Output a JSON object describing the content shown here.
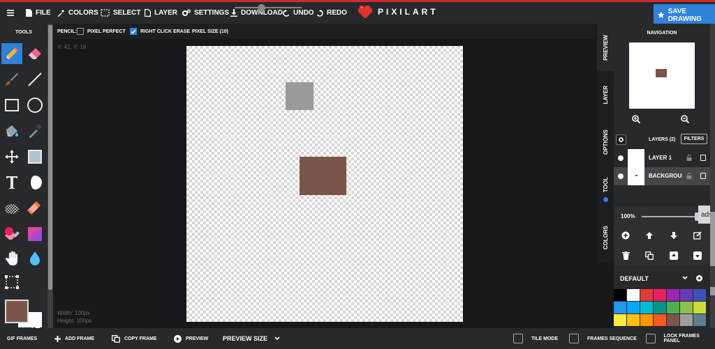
{
  "topbar": {
    "file": "FILE",
    "colors": "COLORS",
    "select": "SELECT",
    "layer": "LAYER",
    "settings": "SETTINGS",
    "download": "DOWNLOAD",
    "undo": "UNDO",
    "redo": "REDO",
    "brand": "PIXILART",
    "save": "SAVE DRAWING"
  },
  "tools": {
    "title": "TOOLS"
  },
  "options": {
    "tool": "PENCIL:",
    "pixel_perfect": "PIXEL PERFECT",
    "right_click_erase": "RIGHT CLICK ERASE",
    "pixel_size": "PIXEL SIZE (10)"
  },
  "canvas": {
    "coords": "X: 42, Y: 19",
    "width": "Width: 100px",
    "height": "Height: 100px"
  },
  "sidetabs": [
    "PREVIEW",
    "LAYER",
    "OPTIONS",
    "TOOL",
    "COLORS"
  ],
  "navigation": {
    "title": "NAVIGATION"
  },
  "layers": {
    "title": "LAYERS (2)",
    "filters": "FILTERS",
    "items": [
      {
        "name": "LAYER 1"
      },
      {
        "name": "BACKGROUND"
      }
    ],
    "opacity": "100%"
  },
  "ads": "ads",
  "palette": {
    "name": "DEFAULT",
    "colors": [
      "#000000",
      "#ffffff",
      "#e53935",
      "#e91e63",
      "#9c27b0",
      "#673ab7",
      "#3f51b5",
      "#2196f3",
      "#03a9f4",
      "#00bcd4",
      "#009688",
      "#4caf50",
      "#8bc34a",
      "#cddc39",
      "#ffeb3b",
      "#ffc107",
      "#ff9800",
      "#ff5722",
      "#795548",
      "#9e9e9e",
      "#607d8b"
    ]
  },
  "bottom": {
    "gif_frames": "GIF FRAMES",
    "add_frame": "ADD FRAME",
    "copy_frame": "COPY FRAME",
    "preview": "PREVIEW",
    "preview_size": "PREVIEW SIZE",
    "tile_mode": "TILE MODE",
    "frames_sequence": "FRAMES SEQUENCE",
    "lock_frames_panel": "LOCK FRAMES PANEL"
  },
  "colors": {
    "primary": "#7b5547",
    "secondary": "#ffffff",
    "accent": "#2e82d8",
    "brand_red": "#cf2a2a"
  }
}
